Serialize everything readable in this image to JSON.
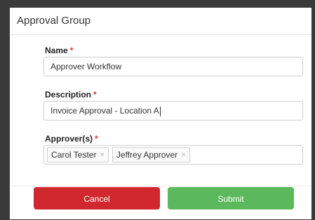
{
  "dialog": {
    "title": "Approval Group"
  },
  "form": {
    "name": {
      "label": "Name",
      "required_mark": "*",
      "value": "Approver Workflow"
    },
    "description": {
      "label": "Description",
      "required_mark": "*",
      "value": "Invoice Approval - Location A"
    },
    "approvers": {
      "label": "Approver(s)",
      "required_mark": "*",
      "tags": [
        {
          "label": "Carol Tester",
          "remove": "×"
        },
        {
          "label": "Jeffrey Approver",
          "remove": "×"
        }
      ]
    }
  },
  "buttons": {
    "cancel": "Cancel",
    "submit": "Submit"
  },
  "colors": {
    "cancel": "#d0282e",
    "submit": "#5cb85c",
    "required": "#d9322d"
  }
}
